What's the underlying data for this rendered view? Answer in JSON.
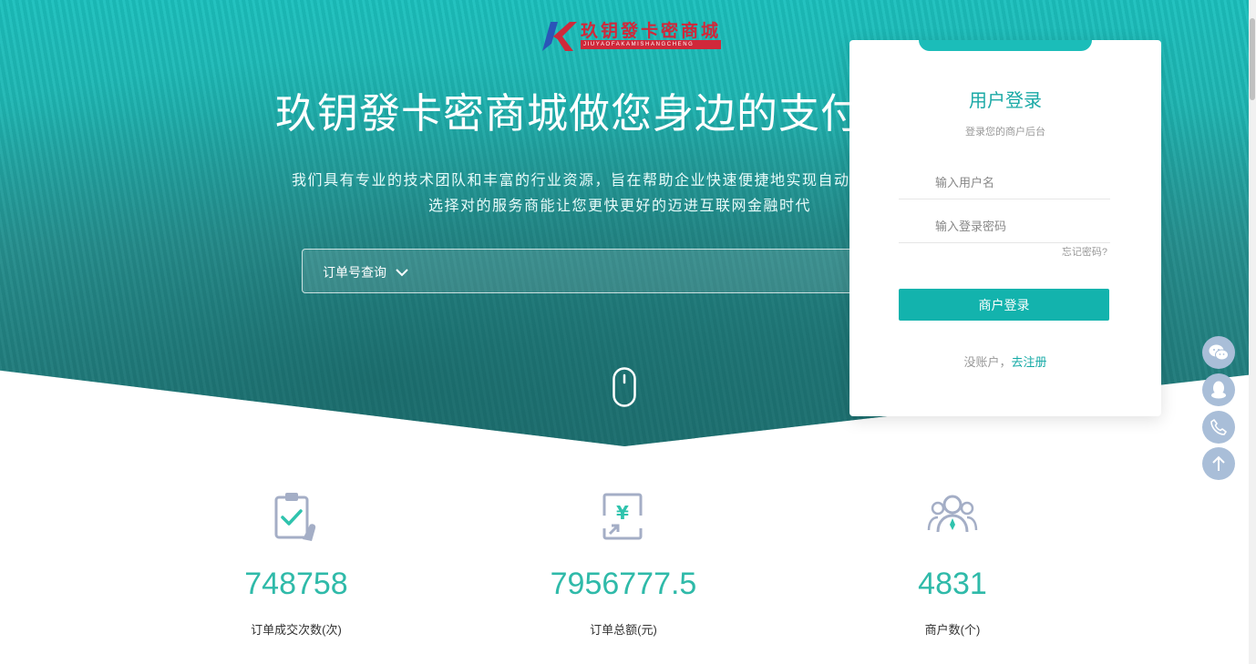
{
  "brand": {
    "logo_text": "玖钥發卡密商城",
    "logo_sub": "JIUYAOFAKAMISHANGCHENG",
    "colors": {
      "primary": "#1bbdb9",
      "accent_red": "#d0283a",
      "side_button": "#a9bed8"
    }
  },
  "hero": {
    "title": "玖钥發卡密商城做您身边的支付",
    "desc_line1": "我们具有专业的技术团队和丰富的行业资源，旨在帮助企业快速便捷地实现自动",
    "desc_line2": "选择对的服务商能让您更快更好的迈进互联网金融时代",
    "order_select_label": "订单号查询",
    "scroll_icon": "mouse-icon"
  },
  "login": {
    "title": "用户登录",
    "subtitle": "登录您的商户后台",
    "username_placeholder": "输入用户名",
    "password_placeholder": "输入登录密码",
    "forgot": "忘记密码?",
    "submit": "商户登录",
    "no_account": "没账户，",
    "register": "去注册"
  },
  "side_buttons": [
    "wechat-icon",
    "qq-icon",
    "phone-icon",
    "back-to-top-icon"
  ],
  "stats": [
    {
      "icon": "clipboard-check-icon",
      "value": "748758",
      "label": "订单成交次数(次)"
    },
    {
      "icon": "yuan-exchange-icon",
      "value": "7956777.5",
      "label": "订单总额(元)"
    },
    {
      "icon": "users-icon",
      "value": "4831",
      "label": "商户数(个)"
    }
  ]
}
